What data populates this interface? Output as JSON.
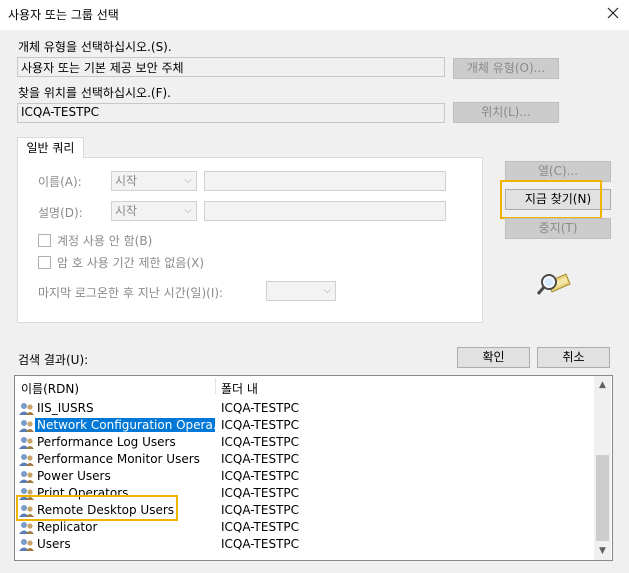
{
  "window": {
    "title": "사용자 또는 그룹 선택"
  },
  "object_type": {
    "label": "개체 유형을 선택하십시오.(S).",
    "value": "사용자 또는 기본 제공 보안 주체",
    "button": "개체 유형(O)..."
  },
  "location": {
    "label": "찾을 위치를 선택하십시오.(F).",
    "value": "ICQA-TESTPC",
    "button": "위치(L)..."
  },
  "query": {
    "tab": "일반 쿼리",
    "name_label": "이름(A):",
    "name_combo": "시작",
    "desc_label": "설명(D):",
    "desc_combo": "시작",
    "disabled_accounts": "계정 사용 안 함(B)",
    "no_expire_password": "암 호 사용 기간 제한 없음(X)",
    "days_since_logon": "마지막 로그온한 후 지난 시간(일)(I):"
  },
  "side_buttons": {
    "columns": "열(C)...",
    "find_now": "지금 찾기(N)",
    "stop": "중지(T)"
  },
  "results": {
    "label": "검색 결과(U):",
    "ok": "확인",
    "cancel": "취소",
    "col_name": "이름(RDN)",
    "col_folder": "폴더 내",
    "rows": [
      {
        "name": "IIS_IUSRS",
        "folder": "ICQA-TESTPC"
      },
      {
        "name": "Network Configuration Opera...",
        "folder": "ICQA-TESTPC"
      },
      {
        "name": "Performance Log Users",
        "folder": "ICQA-TESTPC"
      },
      {
        "name": "Performance Monitor Users",
        "folder": "ICQA-TESTPC"
      },
      {
        "name": "Power Users",
        "folder": "ICQA-TESTPC"
      },
      {
        "name": "Print Operators",
        "folder": "ICQA-TESTPC"
      },
      {
        "name": "Remote Desktop Users",
        "folder": "ICQA-TESTPC"
      },
      {
        "name": "Replicator",
        "folder": "ICQA-TESTPC"
      },
      {
        "name": "Users",
        "folder": "ICQA-TESTPC"
      }
    ]
  },
  "colors": {
    "selection": "#0078d7",
    "highlight": "#f0b400"
  },
  "icons": [
    "close-icon",
    "find-icon",
    "group-icon",
    "scroll-up-icon",
    "scroll-down-icon",
    "chevron-down-icon"
  ]
}
